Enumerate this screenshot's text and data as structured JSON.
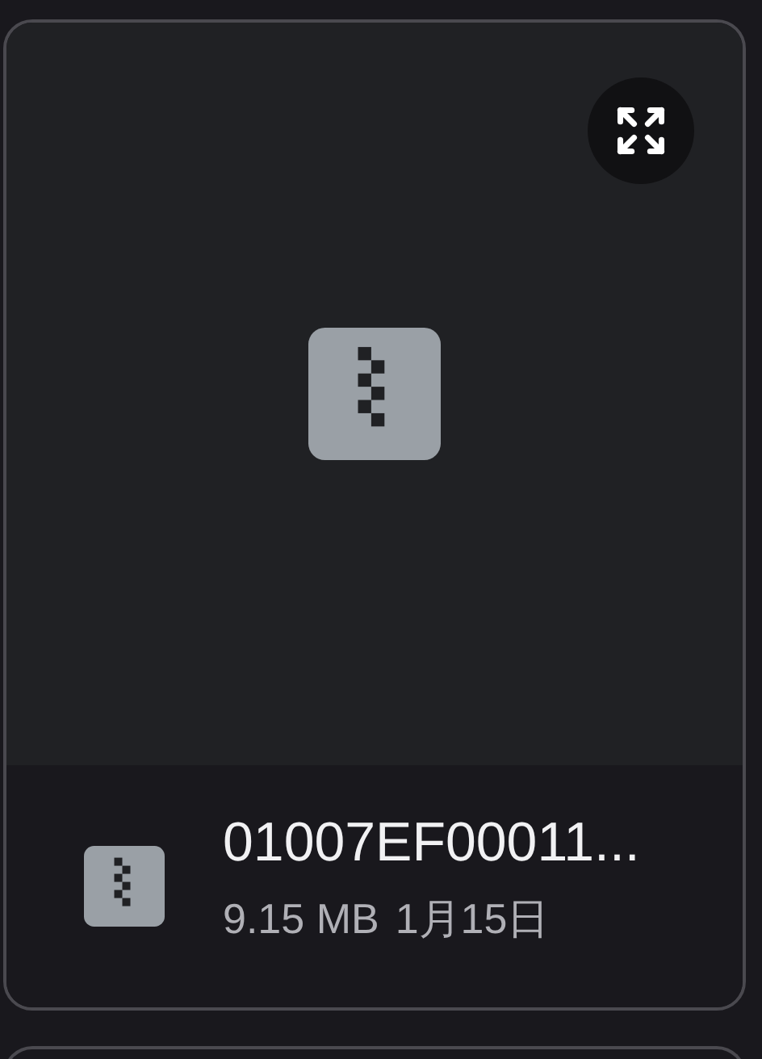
{
  "file": {
    "name": "01007EF00011...",
    "size": "9.15 MB",
    "date": "1月15日"
  }
}
